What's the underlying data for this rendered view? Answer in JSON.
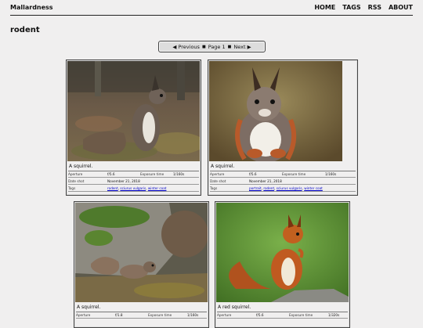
{
  "site": {
    "title": "Mallardness",
    "nav": [
      "HOME",
      "TAGS",
      "RSS",
      "ABOUT"
    ]
  },
  "page": {
    "title": "rodent"
  },
  "pager": {
    "prev": "◀ Previous",
    "sep": "■",
    "page": "Page 1",
    "next": "Next ▶"
  },
  "labels": {
    "aperture": "Aperture",
    "exposure": "Exposure time",
    "date": "Date shot",
    "tags": "Tags"
  },
  "photos": [
    {
      "caption": "A squirrel.",
      "aperture": "f/5.6",
      "exposure": "1/160s",
      "date": "November 21, 2018",
      "tags": [
        "rodent",
        "sciurus vulgaris",
        "winter coat"
      ]
    },
    {
      "caption": "A squirrel.",
      "aperture": "f/5.6",
      "exposure": "1/160s",
      "date": "November 21, 2018",
      "tags": [
        "portrait",
        "rodent",
        "sciurus vulgaris",
        "winter coat"
      ]
    },
    {
      "caption": "A squirrel.",
      "aperture": "f/1.8",
      "exposure": "1/160s"
    },
    {
      "caption": "A red squirrel.",
      "aperture": "f/5.6",
      "exposure": "1/320s"
    }
  ]
}
